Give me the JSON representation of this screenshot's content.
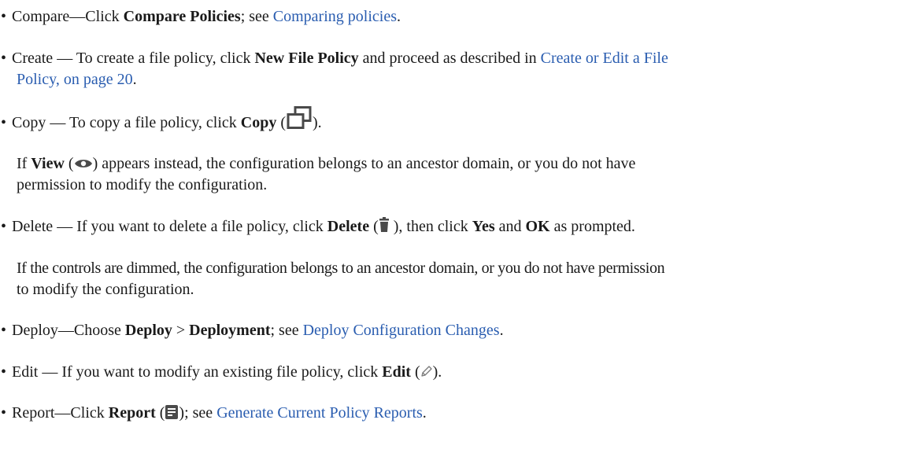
{
  "items": {
    "compare": {
      "bullet": "•",
      "lead": "Compare—Click ",
      "bold": "Compare Policies",
      "mid": "; see ",
      "link": "Comparing policies",
      "tail": "."
    },
    "create": {
      "bullet": "•",
      "lead": "Create — To create a file policy, click ",
      "bold": "New File Policy",
      "mid": " and proceed as described in ",
      "link_line1": "Create or Edit a File",
      "link_line2": "Policy, on page 20",
      "tail": "."
    },
    "copy": {
      "bullet": "•",
      "lead": "Copy — To copy a file policy, click ",
      "bold": "Copy",
      "open": " (",
      "icon": "copy-icon",
      "close": ")."
    },
    "copy_note": {
      "lead": "If ",
      "bold": "View",
      "open": " (",
      "icon": "eye-icon",
      "rest": ") appears instead, the configuration belongs to an ancestor domain, or you do not have",
      "line2": "permission to modify the configuration."
    },
    "delete": {
      "bullet": "•",
      "lead": "Delete — If you want to delete a file policy, click ",
      "bold": "Delete",
      "open": " (",
      "icon": "trash-icon",
      "mid": " ), then click ",
      "bold2": "Yes",
      "and": " and ",
      "bold3": "OK",
      "tail": " as prompted."
    },
    "delete_note": {
      "line1": "If the controls are dimmed, the configuration belongs to an ancestor domain, or you do not have permission",
      "line2": "to modify the configuration."
    },
    "deploy": {
      "bullet": "•",
      "lead": "Deploy—Choose ",
      "bold": "Deploy",
      "sep": " > ",
      "bold2": "Deployment",
      "mid": "; see ",
      "link": "Deploy Configuration Changes",
      "tail": "."
    },
    "edit": {
      "bullet": "•",
      "lead": "Edit — If you want to modify an existing file policy, click ",
      "bold": "Edit",
      "open": " (",
      "icon": "pencil-icon",
      "close": ")."
    },
    "report": {
      "bullet": "•",
      "lead": "Report—Click ",
      "bold": "Report",
      "open": " (",
      "icon": "report-icon",
      "mid": "); see ",
      "link": "Generate Current Policy Reports",
      "tail": "."
    }
  },
  "colors": {
    "text": "#1a1a1a",
    "link": "#2a5db0",
    "icon": "#4a4a4a"
  }
}
